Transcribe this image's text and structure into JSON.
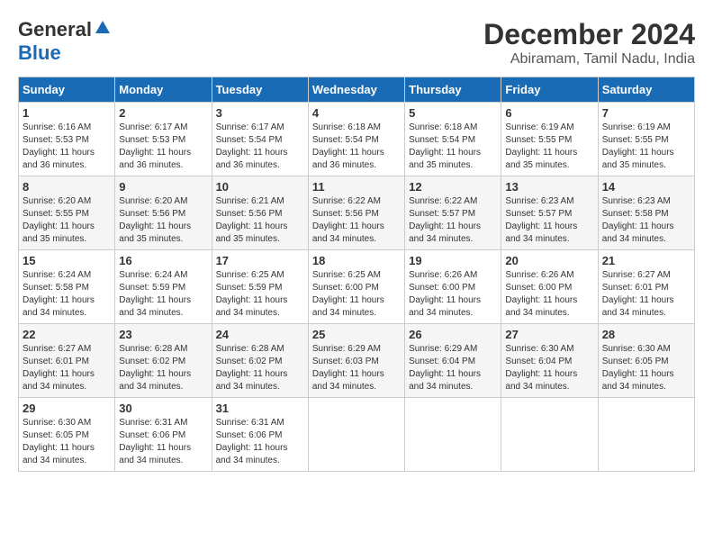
{
  "header": {
    "logo_general": "General",
    "logo_blue": "Blue",
    "title": "December 2024",
    "subtitle": "Abiramam, Tamil Nadu, India"
  },
  "weekdays": [
    "Sunday",
    "Monday",
    "Tuesday",
    "Wednesday",
    "Thursday",
    "Friday",
    "Saturday"
  ],
  "weeks": [
    [
      {
        "day": "1",
        "sunrise": "6:16 AM",
        "sunset": "5:53 PM",
        "daylight": "11 hours and 36 minutes."
      },
      {
        "day": "2",
        "sunrise": "6:17 AM",
        "sunset": "5:53 PM",
        "daylight": "11 hours and 36 minutes."
      },
      {
        "day": "3",
        "sunrise": "6:17 AM",
        "sunset": "5:54 PM",
        "daylight": "11 hours and 36 minutes."
      },
      {
        "day": "4",
        "sunrise": "6:18 AM",
        "sunset": "5:54 PM",
        "daylight": "11 hours and 36 minutes."
      },
      {
        "day": "5",
        "sunrise": "6:18 AM",
        "sunset": "5:54 PM",
        "daylight": "11 hours and 35 minutes."
      },
      {
        "day": "6",
        "sunrise": "6:19 AM",
        "sunset": "5:55 PM",
        "daylight": "11 hours and 35 minutes."
      },
      {
        "day": "7",
        "sunrise": "6:19 AM",
        "sunset": "5:55 PM",
        "daylight": "11 hours and 35 minutes."
      }
    ],
    [
      {
        "day": "8",
        "sunrise": "6:20 AM",
        "sunset": "5:55 PM",
        "daylight": "11 hours and 35 minutes."
      },
      {
        "day": "9",
        "sunrise": "6:20 AM",
        "sunset": "5:56 PM",
        "daylight": "11 hours and 35 minutes."
      },
      {
        "day": "10",
        "sunrise": "6:21 AM",
        "sunset": "5:56 PM",
        "daylight": "11 hours and 35 minutes."
      },
      {
        "day": "11",
        "sunrise": "6:22 AM",
        "sunset": "5:56 PM",
        "daylight": "11 hours and 34 minutes."
      },
      {
        "day": "12",
        "sunrise": "6:22 AM",
        "sunset": "5:57 PM",
        "daylight": "11 hours and 34 minutes."
      },
      {
        "day": "13",
        "sunrise": "6:23 AM",
        "sunset": "5:57 PM",
        "daylight": "11 hours and 34 minutes."
      },
      {
        "day": "14",
        "sunrise": "6:23 AM",
        "sunset": "5:58 PM",
        "daylight": "11 hours and 34 minutes."
      }
    ],
    [
      {
        "day": "15",
        "sunrise": "6:24 AM",
        "sunset": "5:58 PM",
        "daylight": "11 hours and 34 minutes."
      },
      {
        "day": "16",
        "sunrise": "6:24 AM",
        "sunset": "5:59 PM",
        "daylight": "11 hours and 34 minutes."
      },
      {
        "day": "17",
        "sunrise": "6:25 AM",
        "sunset": "5:59 PM",
        "daylight": "11 hours and 34 minutes."
      },
      {
        "day": "18",
        "sunrise": "6:25 AM",
        "sunset": "6:00 PM",
        "daylight": "11 hours and 34 minutes."
      },
      {
        "day": "19",
        "sunrise": "6:26 AM",
        "sunset": "6:00 PM",
        "daylight": "11 hours and 34 minutes."
      },
      {
        "day": "20",
        "sunrise": "6:26 AM",
        "sunset": "6:00 PM",
        "daylight": "11 hours and 34 minutes."
      },
      {
        "day": "21",
        "sunrise": "6:27 AM",
        "sunset": "6:01 PM",
        "daylight": "11 hours and 34 minutes."
      }
    ],
    [
      {
        "day": "22",
        "sunrise": "6:27 AM",
        "sunset": "6:01 PM",
        "daylight": "11 hours and 34 minutes."
      },
      {
        "day": "23",
        "sunrise": "6:28 AM",
        "sunset": "6:02 PM",
        "daylight": "11 hours and 34 minutes."
      },
      {
        "day": "24",
        "sunrise": "6:28 AM",
        "sunset": "6:02 PM",
        "daylight": "11 hours and 34 minutes."
      },
      {
        "day": "25",
        "sunrise": "6:29 AM",
        "sunset": "6:03 PM",
        "daylight": "11 hours and 34 minutes."
      },
      {
        "day": "26",
        "sunrise": "6:29 AM",
        "sunset": "6:04 PM",
        "daylight": "11 hours and 34 minutes."
      },
      {
        "day": "27",
        "sunrise": "6:30 AM",
        "sunset": "6:04 PM",
        "daylight": "11 hours and 34 minutes."
      },
      {
        "day": "28",
        "sunrise": "6:30 AM",
        "sunset": "6:05 PM",
        "daylight": "11 hours and 34 minutes."
      }
    ],
    [
      {
        "day": "29",
        "sunrise": "6:30 AM",
        "sunset": "6:05 PM",
        "daylight": "11 hours and 34 minutes."
      },
      {
        "day": "30",
        "sunrise": "6:31 AM",
        "sunset": "6:06 PM",
        "daylight": "11 hours and 34 minutes."
      },
      {
        "day": "31",
        "sunrise": "6:31 AM",
        "sunset": "6:06 PM",
        "daylight": "11 hours and 34 minutes."
      },
      null,
      null,
      null,
      null
    ]
  ],
  "labels": {
    "sunrise": "Sunrise:",
    "sunset": "Sunset:",
    "daylight": "Daylight:"
  }
}
